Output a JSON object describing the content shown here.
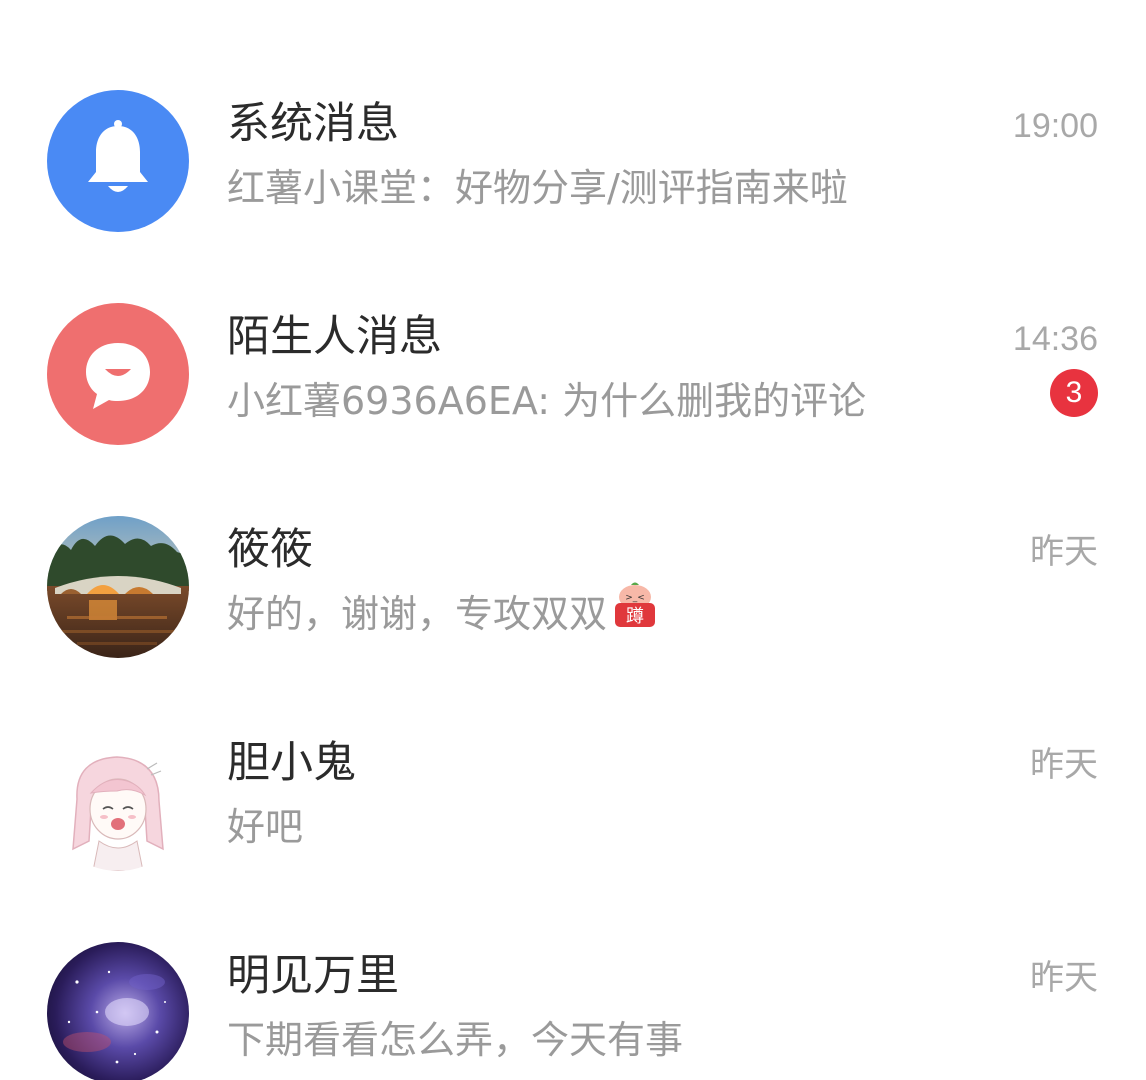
{
  "conversations": [
    {
      "name": "系统消息",
      "preview": "红薯小课堂：好物分享/测评指南来啦",
      "time": "19:00",
      "avatar_icon": "bell-icon",
      "avatar_color": "#4a8af4"
    },
    {
      "name": "陌生人消息",
      "preview": "小红薯6936A6EA: 为什么删我的评论",
      "time": "14:36",
      "unread_count": "3",
      "avatar_icon": "chat-bubble-icon",
      "avatar_color": "#ef6f6f"
    },
    {
      "name": "筱筱",
      "preview": "好的，谢谢，专攻双双",
      "time": "昨天",
      "sticker_icon": "cute-peach-sticker-icon",
      "sticker_text": "蹲",
      "avatar_icon": "bridge-photo-icon"
    },
    {
      "name": "胆小鬼",
      "preview": "好吧",
      "time": "昨天",
      "avatar_icon": "anime-girl-sketch-icon"
    },
    {
      "name": "明见万里",
      "preview": "下期看看怎么弄，今天有事",
      "time": "昨天",
      "avatar_icon": "galaxy-photo-icon"
    }
  ],
  "colors": {
    "badge": "#e8333f",
    "name_text": "#2b2b2b",
    "preview_text": "#9a9a9a",
    "time_text": "#a8a8a8"
  }
}
